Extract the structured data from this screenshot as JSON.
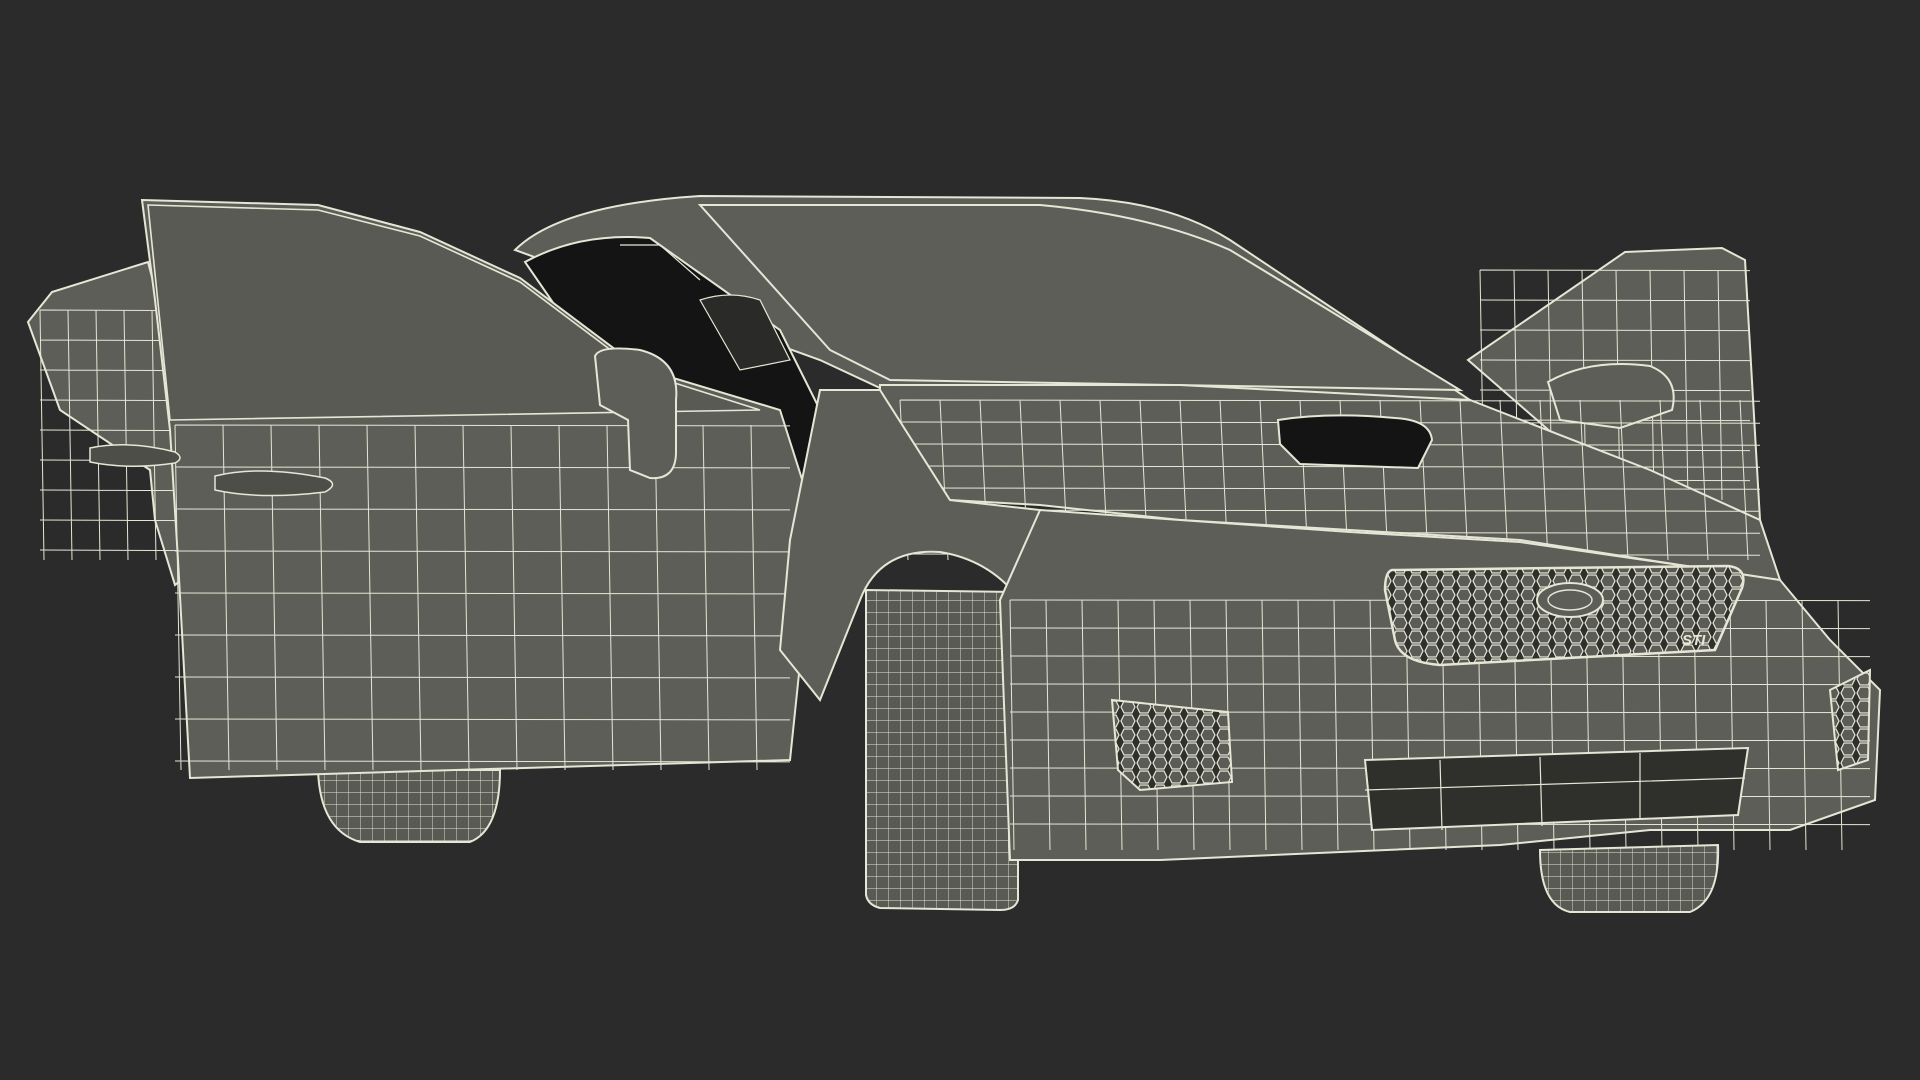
{
  "scene": {
    "subject": "wireframe-car",
    "background_color": "#2b2b2b",
    "body_fill": "#5e5e58",
    "body_fill_dark": "#4e4e49",
    "wire_color": "#e6e6d6",
    "interior_color": "#141414"
  },
  "car": {
    "grille_badge": "STI"
  }
}
